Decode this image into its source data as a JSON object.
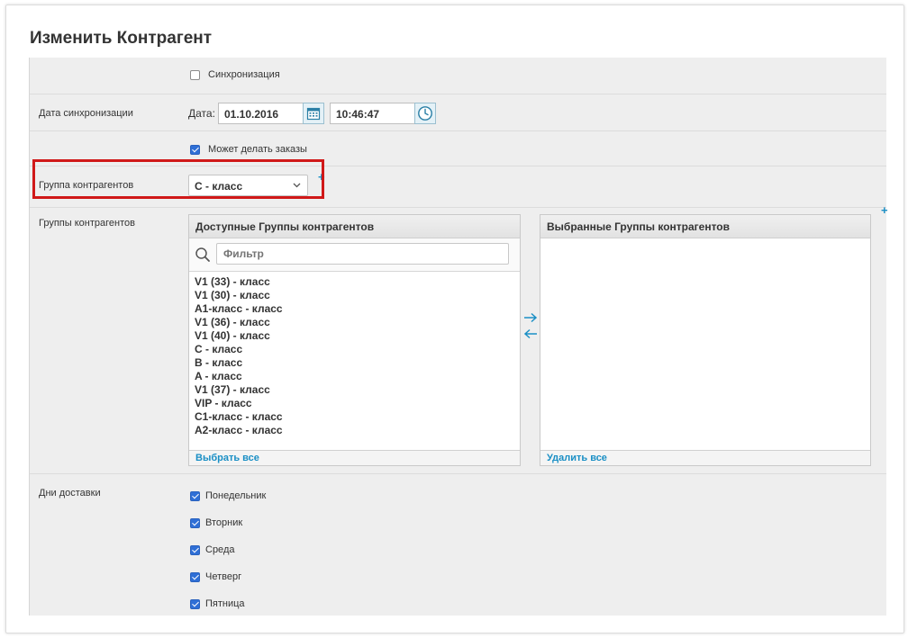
{
  "page": {
    "title": "Изменить Контрагент"
  },
  "sync": {
    "checkbox_label": "Синхронизация",
    "checked": false
  },
  "sync_date": {
    "label": "Дата синхронизации",
    "date_prefix": "Дата:",
    "date_value": "01.10.2016",
    "time_value": "10:46:47"
  },
  "can_order": {
    "checkbox_label": "Может делать заказы",
    "checked": true
  },
  "group": {
    "label": "Группа контрагентов",
    "selected": "C - класс",
    "add_symbol": "+"
  },
  "groups": {
    "label": "Группы контрагентов",
    "available": {
      "title": "Доступные Группы контрагентов",
      "filter_placeholder": "Фильтр",
      "items": [
        "V1 (33) - класс",
        "V1 (30) - класс",
        "A1-класс - класс",
        "V1 (36) - класс",
        "V1 (40) - класс",
        "C - класс",
        "B - класс",
        "A - класс",
        "V1 (37) - класс",
        "VIP - класс",
        "C1-класс - класс",
        "A2-класс - класс"
      ],
      "footer_link": "Выбрать все"
    },
    "selected": {
      "title": "Выбранные Группы контрагентов",
      "items": [],
      "footer_link": "Удалить все"
    },
    "move_right_symbol": "→",
    "move_left_symbol": "←",
    "add_symbol": "+"
  },
  "delivery": {
    "label": "Дни доставки",
    "days": [
      {
        "label": "Понедельник",
        "checked": true
      },
      {
        "label": "Вторник",
        "checked": true
      },
      {
        "label": "Среда",
        "checked": true
      },
      {
        "label": "Четверг",
        "checked": true
      },
      {
        "label": "Пятница",
        "checked": true
      }
    ]
  },
  "colors": {
    "accent": "#1a8fc5",
    "checkbox": "#2f6fd6",
    "highlight": "#d01818"
  },
  "icons": [
    "calendar-icon",
    "clock-icon",
    "chevron-down-icon",
    "search-icon",
    "arrow-right-icon",
    "arrow-left-icon",
    "plus-icon"
  ]
}
